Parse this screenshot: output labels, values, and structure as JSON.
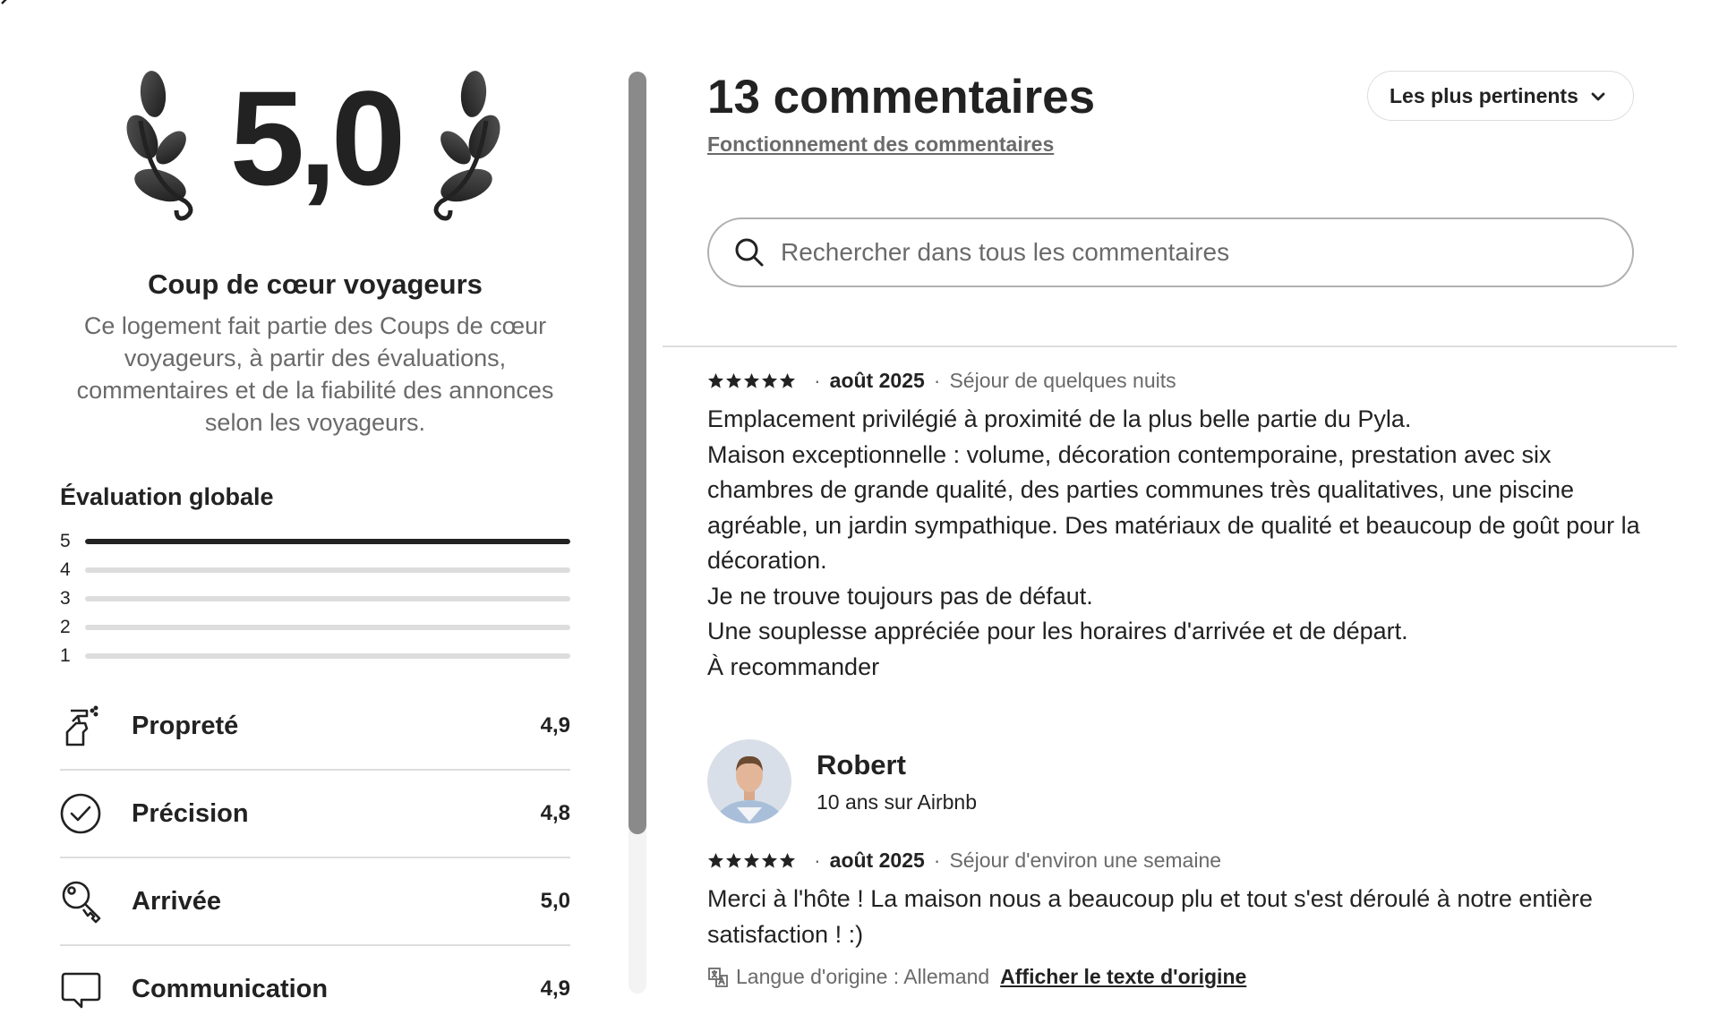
{
  "rating": {
    "score": "5,0",
    "badge_title": "Coup de cœur voyageurs",
    "badge_description": "Ce logement fait partie des Coups de cœur voyageurs, à partir des évaluations, commentaires et de la fiabilité des annonces selon les voyageurs."
  },
  "overall": {
    "label": "Évaluation globale",
    "bars": [
      {
        "stars": "5",
        "fraction": 1.0
      },
      {
        "stars": "4",
        "fraction": 0.0
      },
      {
        "stars": "3",
        "fraction": 0.0
      },
      {
        "stars": "2",
        "fraction": 0.0
      },
      {
        "stars": "1",
        "fraction": 0.0
      }
    ]
  },
  "categories": [
    {
      "label": "Propreté",
      "value": "4,9",
      "icon": "spray-bottle-icon"
    },
    {
      "label": "Précision",
      "value": "4,8",
      "icon": "check-circle-icon"
    },
    {
      "label": "Arrivée",
      "value": "5,0",
      "icon": "key-icon"
    },
    {
      "label": "Communication",
      "value": "4,9",
      "icon": "chat-bubble-icon"
    }
  ],
  "reviews_header": {
    "count_title": "13 commentaires",
    "how_link": "Fonctionnement des commentaires",
    "sort_label": "Les plus pertinents"
  },
  "search": {
    "placeholder": "Rechercher dans tous les commentaires"
  },
  "reviews": [
    {
      "date": "août 2025",
      "stay": "Séjour de quelques nuits",
      "lines": [
        "Emplacement privilégié à proximité de la plus belle partie du Pyla.",
        "Maison exceptionnelle : volume, décoration contemporaine, prestation avec six chambres de grande qualité, des parties communes très qualitatives, une piscine agréable, un jardin sympathique. Des matériaux de qualité et beaucoup de goût pour la décoration.",
        "Je ne trouve toujours pas de défaut.",
        "Une souplesse appréciée pour les horaires d'arrivée et de départ.",
        "À recommander"
      ]
    },
    {
      "reviewer_name": "Robert",
      "reviewer_tenure": "10 ans sur Airbnb",
      "date": "août 2025",
      "stay": "Séjour d'environ une semaine",
      "lines": [
        "Merci à l'hôte ! La maison nous a beaucoup plu et tout s'est déroulé à notre entière satisfaction ! :)"
      ],
      "translation_note": "Langue d'origine : Allemand",
      "translation_link": "Afficher le texte d'origine"
    }
  ],
  "meta_separator": "·",
  "colors": {
    "text": "#222222",
    "secondary": "#6a6a6a",
    "divider": "#dddddd"
  }
}
